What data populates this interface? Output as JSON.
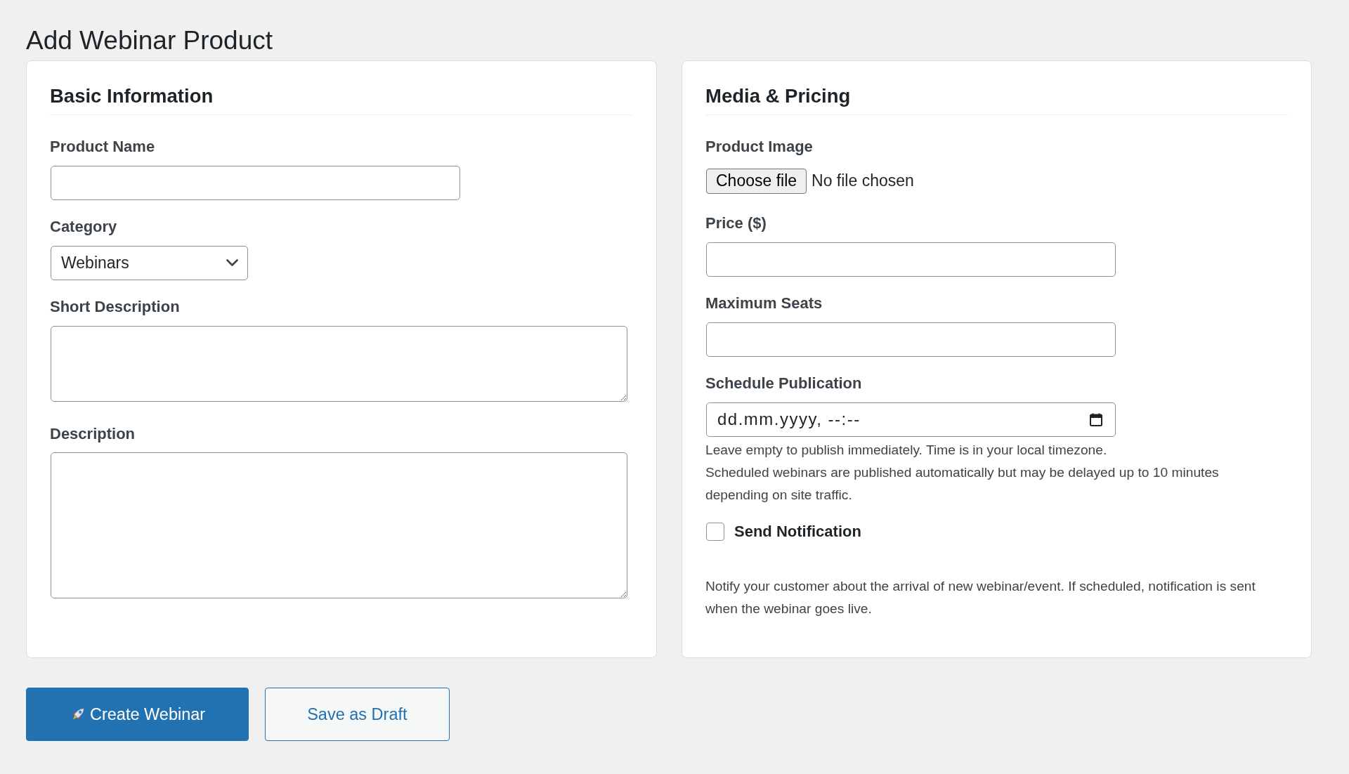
{
  "page": {
    "title": "Add Webinar Product"
  },
  "cards": [
    {
      "title": "Basic Information",
      "fields": [
        {
          "kind": "text",
          "label": "Product Name"
        },
        {
          "kind": "select",
          "label": "Category",
          "value": "Webinars"
        },
        {
          "kind": "textarea",
          "label": "Short Description"
        },
        {
          "kind": "textarea",
          "label": "Description"
        }
      ]
    },
    {
      "title": "Media & Pricing",
      "fields": [
        {
          "kind": "file",
          "label": "Product Image",
          "button": "Choose file",
          "status": "No file chosen"
        },
        {
          "kind": "text",
          "label": "Price ($)"
        },
        {
          "kind": "text",
          "label": "Maximum Seats"
        },
        {
          "kind": "datetime",
          "label": "Schedule Publication",
          "placeholder": "dd.mm.yyyy, --:--",
          "help": [
            "Leave empty to publish immediately. Time is in your local timezone.",
            "Scheduled webinars are published automatically but may be delayed up to 10 minutes depending on site traffic."
          ]
        },
        {
          "kind": "checkbox",
          "label": "Send Notification",
          "checked": false,
          "help": [
            "Notify your customer about the arrival of new webinar/event. If scheduled, notification is sent when the webinar goes live."
          ]
        }
      ]
    }
  ],
  "actions": [
    {
      "kind": "primary",
      "label": "Create Webinar"
    },
    {
      "kind": "secondary",
      "label": "Save as Draft"
    }
  ]
}
